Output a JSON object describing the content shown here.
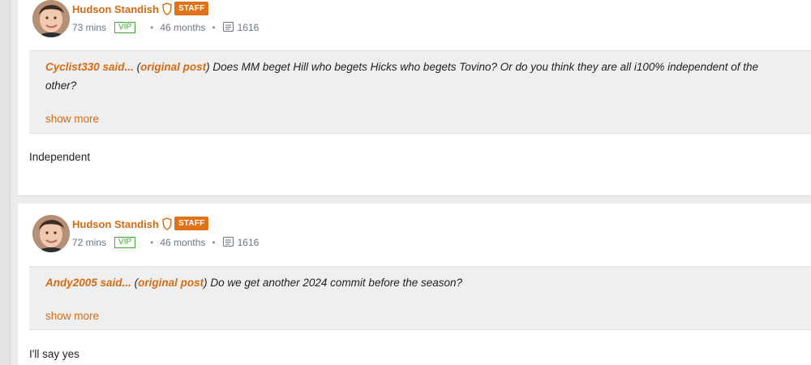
{
  "posts": [
    {
      "author": "Hudson Standish",
      "badge": "STAFF",
      "time": "73 mins",
      "vip": "VIP",
      "months": "46 months",
      "comments": "1616",
      "quote_user": "Cyclist330 said...",
      "quote_link": "original post",
      "quote_body": "Does MM beget Hill who begets Hicks who begets Tovino? Or do you think they are all i100% independent of the other?",
      "show_more": "show more",
      "reply": "Independent"
    },
    {
      "author": "Hudson Standish",
      "badge": "STAFF",
      "time": "72 mins",
      "vip": "VIP",
      "months": "46 months",
      "comments": "1616",
      "quote_user": "Andy2005 said...",
      "quote_link": "original post",
      "quote_body": "Do we get another 2024 commit before the season?",
      "show_more": "show more",
      "reply": "I'll say yes"
    }
  ],
  "colors": {
    "accent": "#d96a12",
    "vip": "#43a935",
    "staff_badge": "#e0731a"
  },
  "icons": [
    "staff-shield-icon",
    "comment-icon",
    "avatar"
  ]
}
